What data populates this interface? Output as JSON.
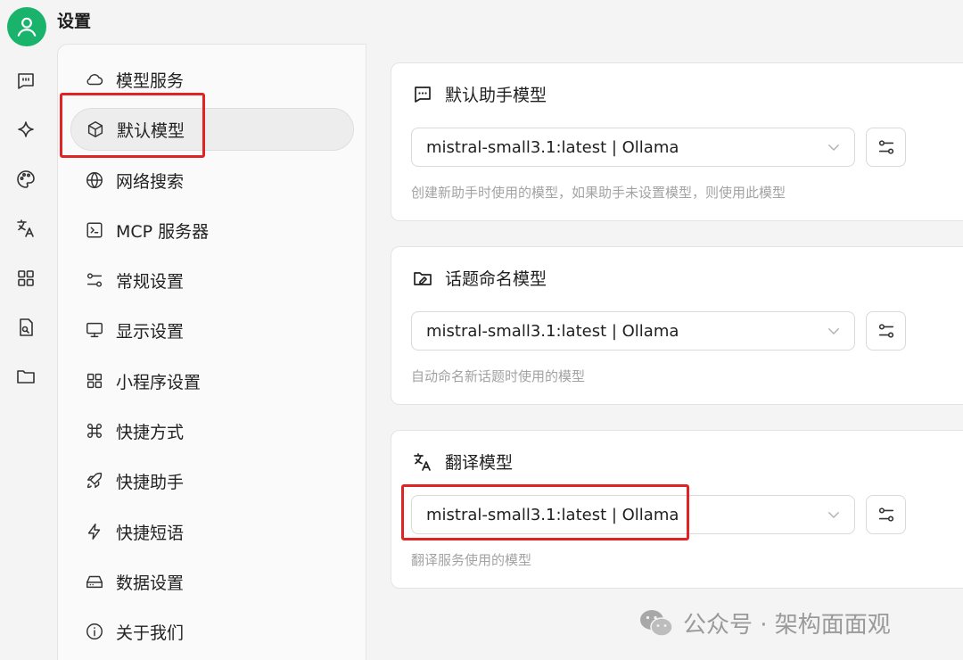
{
  "app": {
    "title": "设置"
  },
  "rail": {
    "icons": [
      "user-icon",
      "chat-icon",
      "sparkle-icon",
      "palette-icon",
      "translate-icon",
      "apps-icon",
      "file-search-icon",
      "folder-icon"
    ]
  },
  "nav": {
    "items": [
      {
        "label": "模型服务",
        "icon": "cloud-icon"
      },
      {
        "label": "默认模型",
        "icon": "cube-icon",
        "active": true
      },
      {
        "label": "网络搜索",
        "icon": "globe-icon"
      },
      {
        "label": "MCP 服务器",
        "icon": "terminal-icon"
      },
      {
        "label": "常规设置",
        "icon": "settings-sliders-icon"
      },
      {
        "label": "显示设置",
        "icon": "monitor-icon"
      },
      {
        "label": "小程序设置",
        "icon": "apps-grid-icon"
      },
      {
        "label": "快捷方式",
        "icon": "command-icon"
      },
      {
        "label": "快捷助手",
        "icon": "rocket-icon"
      },
      {
        "label": "快捷短语",
        "icon": "zap-icon"
      },
      {
        "label": "数据设置",
        "icon": "hard-drive-icon"
      },
      {
        "label": "关于我们",
        "icon": "info-icon"
      }
    ]
  },
  "cards": [
    {
      "title": "默认助手模型",
      "icon": "chat-icon",
      "selected": "mistral-small3.1:latest | Ollama",
      "hint": "创建新助手时使用的模型，如果助手未设置模型，则使用此模型"
    },
    {
      "title": "话题命名模型",
      "icon": "folder-edit-icon",
      "selected": "mistral-small3.1:latest | Ollama",
      "hint": "自动命名新话题时使用的模型"
    },
    {
      "title": "翻译模型",
      "icon": "translate-icon",
      "selected": "mistral-small3.1:latest | Ollama",
      "hint": "翻译服务使用的模型"
    }
  ],
  "watermark": {
    "text": "公众号 · 架构面面观"
  },
  "colors": {
    "accent": "#19b36b",
    "highlight": "#e02424"
  }
}
